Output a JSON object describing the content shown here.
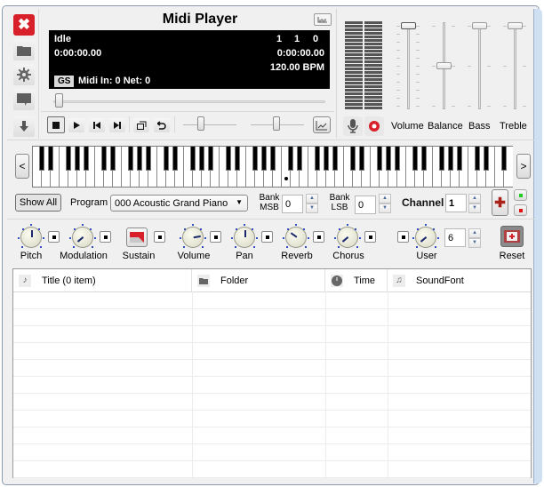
{
  "window": {
    "title": "Midi Player"
  },
  "sidebar": {
    "items": [
      {
        "name": "close",
        "icon": "close-icon"
      },
      {
        "name": "open-folder",
        "icon": "folder-icon"
      },
      {
        "name": "settings",
        "icon": "gear-icon"
      },
      {
        "name": "comment",
        "icon": "speech-bubble-icon"
      },
      {
        "name": "download",
        "icon": "arrow-down-icon"
      }
    ]
  },
  "display": {
    "status": "Idle",
    "elapsed": "0:00:00.00",
    "position": {
      "measure": "1",
      "beat": "1",
      "tick": "0"
    },
    "total_time": "0:00:00.00",
    "tempo": "120.00 BPM",
    "mode_badge": "GS",
    "midi_info": "Midi In: 0  Net: 0"
  },
  "transport": {
    "seek_fraction": 0.0,
    "buttons": [
      "stop",
      "play",
      "previous",
      "next",
      "mini-mode",
      "repeat"
    ],
    "speed_slider_fraction": 0.4,
    "pitch_slider_fraction": 0.55
  },
  "mixer": {
    "sliders": [
      {
        "label": "Volume",
        "value": 1.0
      },
      {
        "label": "Balance",
        "value": 0.5
      },
      {
        "label": "Bass",
        "value": 1.0
      },
      {
        "label": "Treble",
        "value": 1.0
      }
    ]
  },
  "keyboard": {
    "white_key_count": 54,
    "start_note": "C",
    "middle_c_marker_index": 28
  },
  "controls": {
    "show_all": "Show All",
    "program_label": "Program",
    "program_value": "000 Acoustic Grand Piano",
    "bank_msb_label_1": "Bank",
    "bank_msb_label_2": "MSB",
    "bank_msb_value": "0",
    "bank_lsb_label_1": "Bank",
    "bank_lsb_label_2": "LSB",
    "bank_lsb_value": "0",
    "channel_label": "Channel",
    "channel_value": "1"
  },
  "knobs": [
    {
      "label": "Pitch",
      "angle": 0
    },
    {
      "label": "Modulation",
      "angle": -130
    },
    {
      "label": "Volume",
      "angle": 80
    },
    {
      "label": "Pan",
      "angle": 0
    },
    {
      "label": "Reverb",
      "angle": -55
    },
    {
      "label": "Chorus",
      "angle": -130
    },
    {
      "label": "User",
      "angle": -130
    }
  ],
  "sustain_label": "Sustain",
  "user_cc_value": "6",
  "reset_label": "Reset",
  "playlist": {
    "columns": [
      {
        "label": "Title  (0 item)",
        "icon": "music-note-icon"
      },
      {
        "label": "Folder",
        "icon": "folder-icon"
      },
      {
        "label": "Time",
        "icon": "clock-icon"
      },
      {
        "label": "SoundFont",
        "icon": "music-notes-icon"
      }
    ],
    "rows": []
  },
  "colors": {
    "accent_red": "#d8202a",
    "led_green": "#22cc22",
    "led_red": "#dd1111",
    "display_bg": "#000000"
  }
}
